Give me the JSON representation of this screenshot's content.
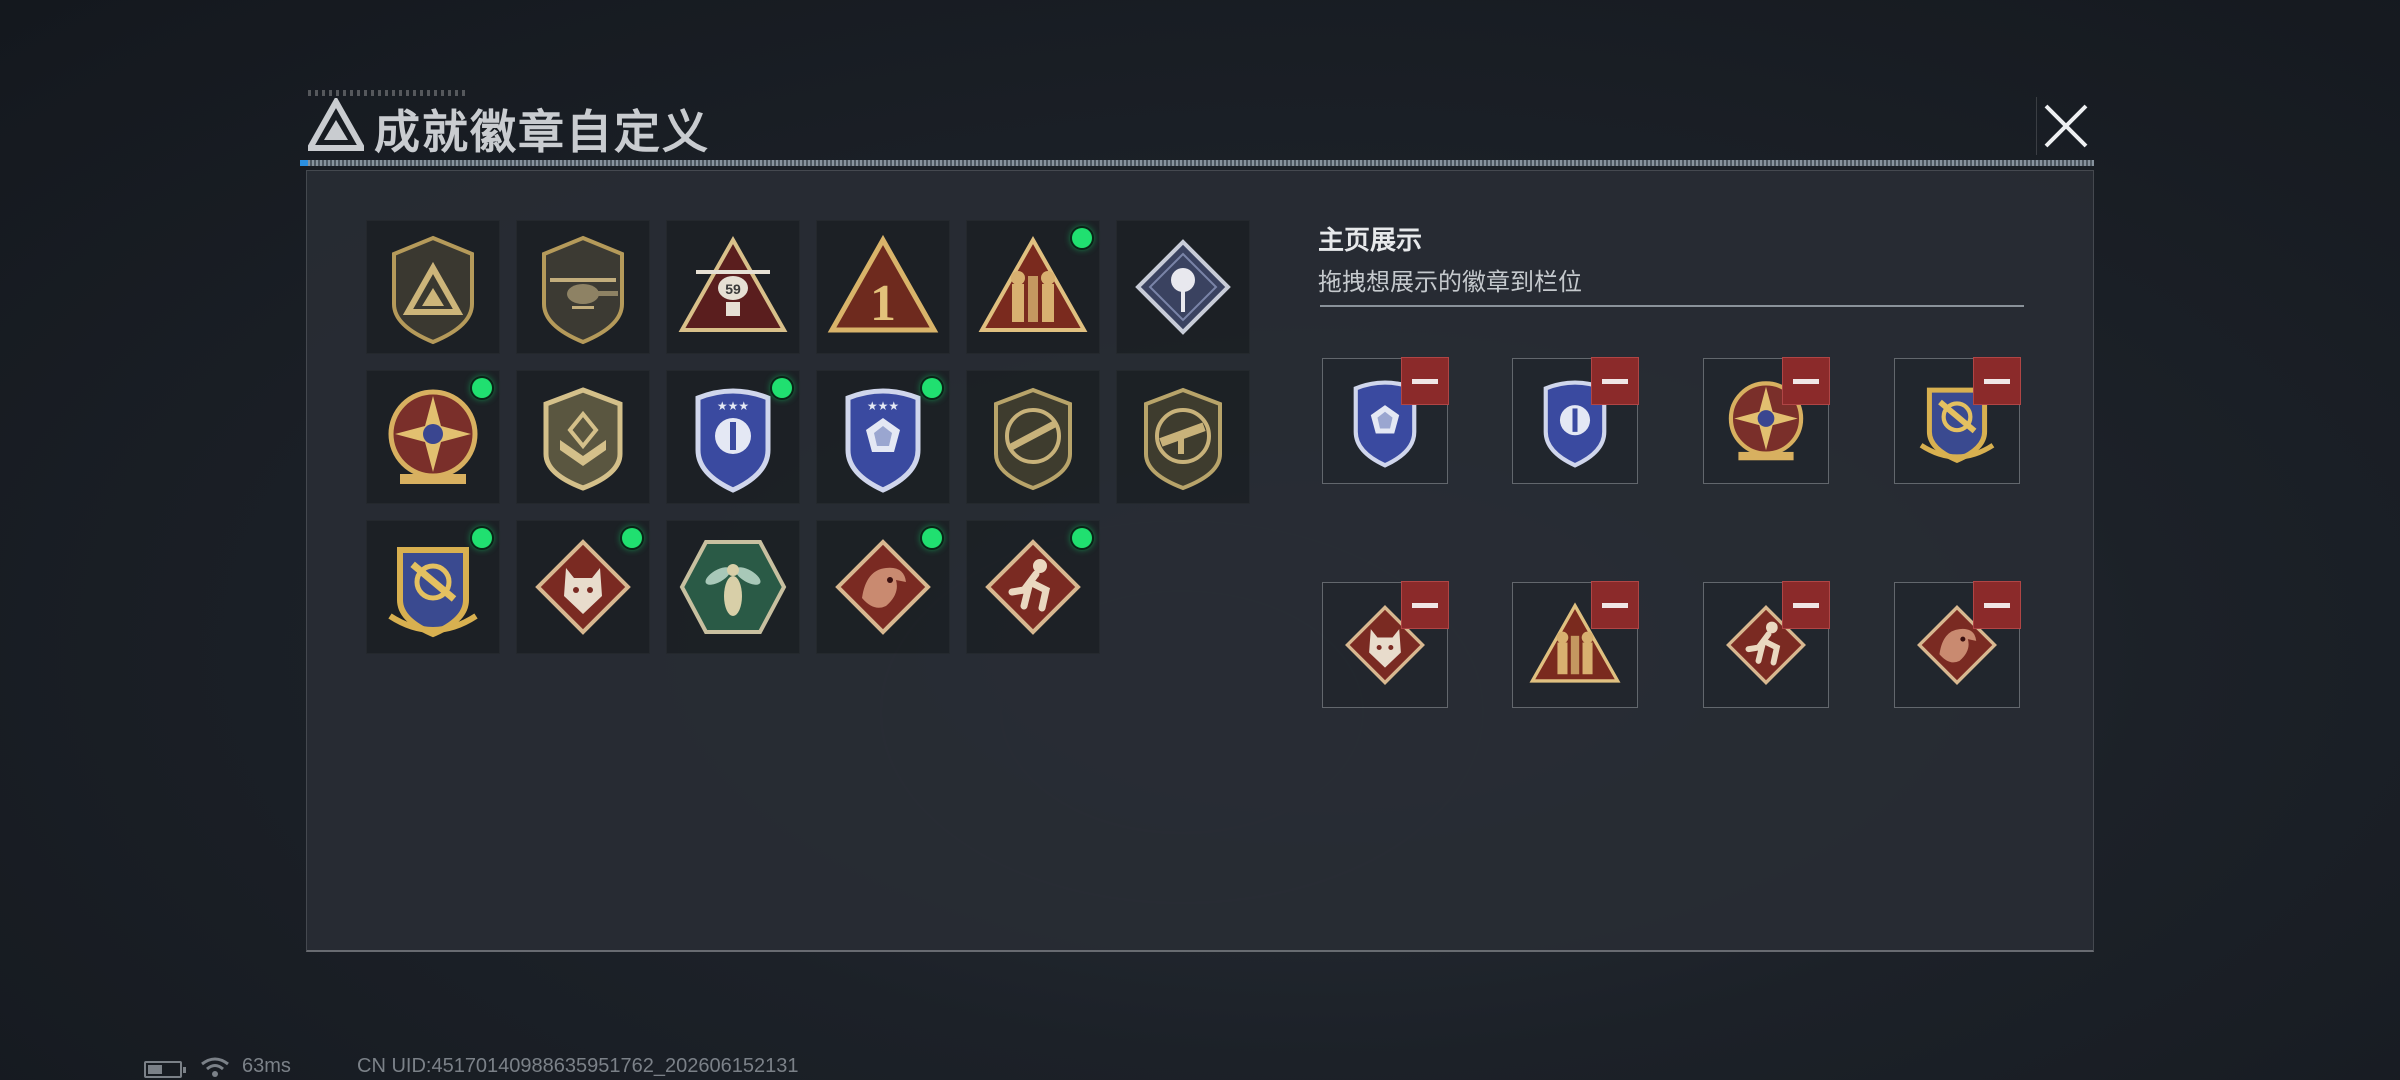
{
  "window": {
    "title": "成就徽章自定义",
    "close_icon": "close-icon",
    "logo_icon": "delta-triangle-logo"
  },
  "badge_grid": {
    "badges": [
      {
        "name": "delta-logo-shield",
        "new": false
      },
      {
        "name": "helicopter-shield",
        "new": false
      },
      {
        "name": "helicopter-59-triangle",
        "new": false
      },
      {
        "name": "number-one-triangle",
        "new": false
      },
      {
        "name": "soldiers-triangle",
        "new": true
      },
      {
        "name": "rose-diamond",
        "new": false
      },
      {
        "name": "star-compass-medal",
        "new": true
      },
      {
        "name": "rank-chevron-shield",
        "new": false
      },
      {
        "name": "blue-shield-emblem",
        "new": true
      },
      {
        "name": "blue-shield-gem",
        "new": true
      },
      {
        "name": "rifle-shield",
        "new": false
      },
      {
        "name": "smg-shield",
        "new": false
      },
      {
        "name": "crossed-tools-gold-shield",
        "new": true
      },
      {
        "name": "wolf-diamond",
        "new": true
      },
      {
        "name": "wasp-hexagon",
        "new": false
      },
      {
        "name": "dragon-diamond",
        "new": true
      },
      {
        "name": "runner-diamond",
        "new": true
      }
    ]
  },
  "showcase": {
    "title": "主页展示",
    "subtitle": "拖拽想展示的徽章到栏位",
    "slots": [
      {
        "badge": "blue-shield-gem"
      },
      {
        "badge": "blue-shield-emblem"
      },
      {
        "badge": "star-compass-medal"
      },
      {
        "badge": "crossed-tools-gold-shield"
      },
      {
        "badge": "wolf-diamond"
      },
      {
        "badge": "soldiers-triangle"
      },
      {
        "badge": "runner-diamond"
      },
      {
        "badge": "dragon-diamond"
      }
    ],
    "remove_icon": "minus-icon"
  },
  "status_bar": {
    "battery_icon": "battery-icon",
    "wifi_icon": "wifi-icon",
    "ping": "63ms",
    "uid": "CN UID:4517014098863595176​2_202606152131"
  },
  "colors": {
    "new_dot": "#20e070",
    "remove_button": "#8b2a2a",
    "panel_bg": "#282d34"
  }
}
